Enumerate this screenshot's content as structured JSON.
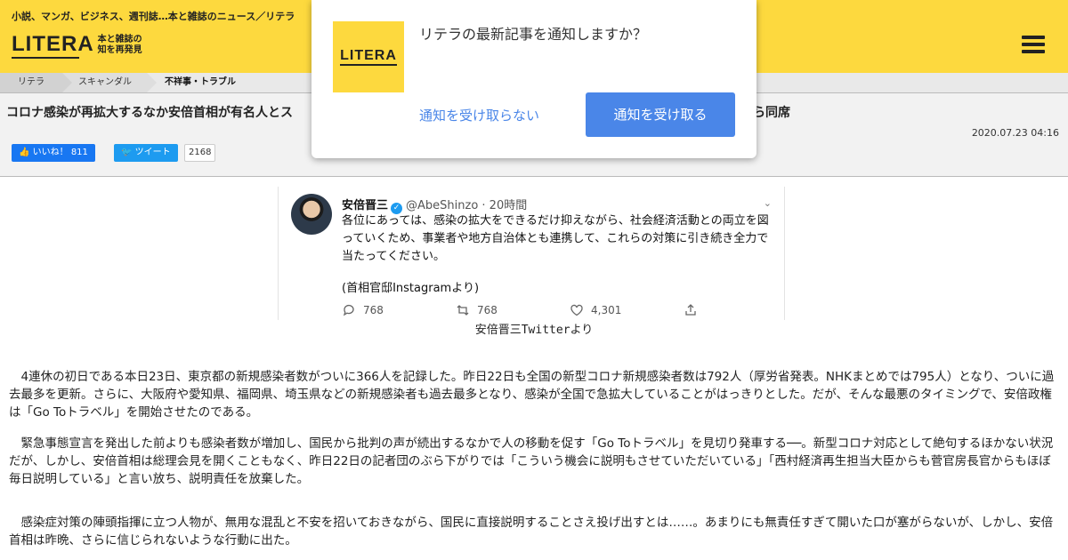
{
  "site": {
    "tagline": "小説、マンガ、ビジネス、週刊誌…本と雑誌のニュース／リテラ",
    "logo_word": "LITERA",
    "logo_sub_line1": "本と雑誌の",
    "logo_sub_line2": "知を再発見"
  },
  "breadcrumb": [
    "リテラ",
    "スキャンダル",
    "不祥事・トラブル"
  ],
  "article": {
    "title_start": "コロナ感染が再拡大するなか安倍首相が有名人とス",
    "title_end": "ら同席",
    "date": "2020.07.23 04:16",
    "like_label": "いいね！ 811",
    "tweet_label": "ツイート",
    "tweet_count": "2168",
    "caption": "安倍晋三Twitterより",
    "paragraphs": [
      "4連休の初日である本日23日、東京都の新規感染者数がついに366人を記録した。昨日22日も全国の新型コロナ新規感染者数は792人（厚労省発表。NHKまとめでは795人）となり、ついに過去最多を更新。さらに、大阪府や愛知県、福岡県、埼玉県などの新規感染者も過去最多となり、感染が全国で急拡大していることがはっきりとした。だが、そんな最悪のタイミングで、安倍政権は「Go Toトラベル」を開始させたのである。",
      "緊急事態宣言を発出した前よりも感染者数が増加し、国民から批判の声が続出するなかで人の移動を促す「Go Toトラベル」を見切り発車する──。新型コロナ対応として絶句するほかない状況だが、しかし、安倍首相は総理会見を開くこともなく、昨日22日の記者団のぶら下がりでは「こういう機会に説明もさせていただいている」「西村経済再生担当大臣からも菅官房長官からもほぼ毎日説明している」と言い放ち、説明責任を放棄した。",
      "感染症対策の陣頭指揮に立つ人物が、無用な混乱と不安を招いておきながら、国民に直接説明することさえ投げ出すとは……。あまりにも無責任すぎて開いた口が塞がらないが、しかし、安倍首相は昨晩、さらに信じられないような行動に出た。"
    ]
  },
  "tweet": {
    "name": "安倍晋三",
    "handle": "@AbeShinzo · 20時間",
    "body": "各位にあっては、感染の拡大をできるだけ抑えながら、社会経済活動との両立を図っていくため、事業者や地方自治体とも連携して、これらの対策に引き続き全力で当たってください。",
    "source": "(首相官邸Instagramより)",
    "replies": "768",
    "retweets": "768",
    "likes": "4,301"
  },
  "popup": {
    "logo_word": "LITERA",
    "message": "リテラの最新記事を通知しますか？",
    "deny": "通知を受け取らない",
    "accept": "通知を受け取る"
  },
  "colors": {
    "header_bg": "#fdd93e",
    "popup_button": "#4a86e8",
    "facebook": "#1877f2",
    "twitter": "#1d9bf0"
  }
}
